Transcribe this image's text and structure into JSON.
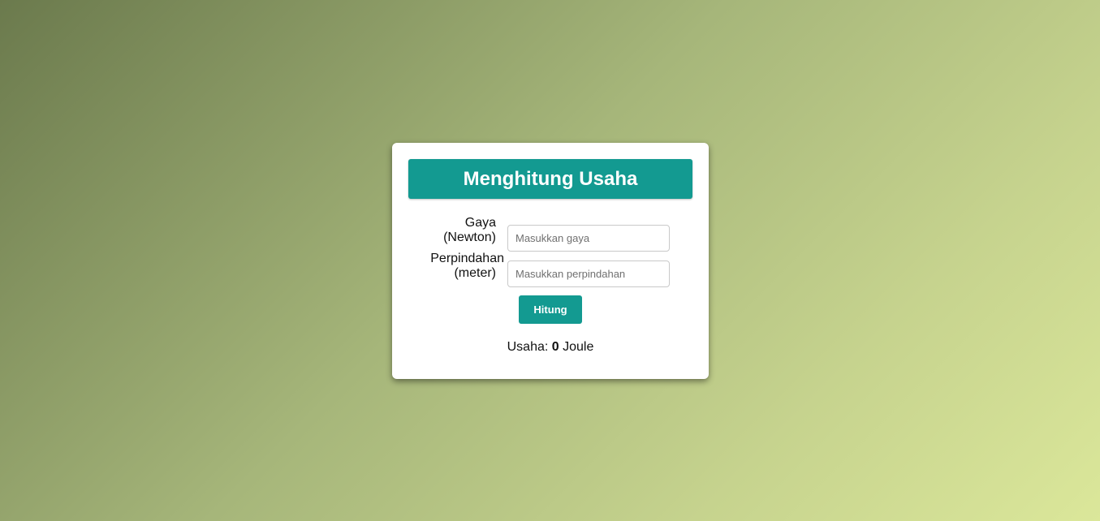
{
  "card": {
    "title": "Menghitung Usaha",
    "gaya": {
      "label_line1": "Gaya",
      "label_line2": "(Newton)",
      "placeholder": "Masukkan gaya",
      "value": ""
    },
    "perpindahan": {
      "label_line1": "Perpindahan",
      "label_line2": "(meter)",
      "placeholder": "Masukkan perpindahan",
      "value": ""
    },
    "button_label": "Hitung",
    "result": {
      "prefix": "Usaha:",
      "value": "0",
      "unit": "Joule"
    }
  },
  "colors": {
    "accent": "#139a91",
    "card_bg": "#ffffff"
  }
}
